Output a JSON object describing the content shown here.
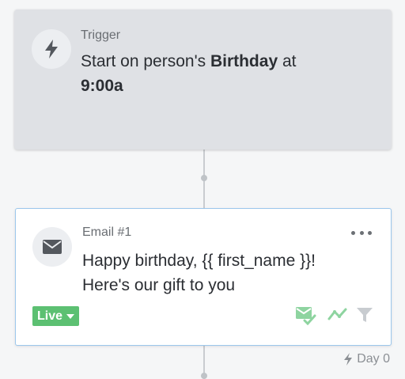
{
  "trigger": {
    "label": "Trigger",
    "text_prefix": "Start on person's ",
    "text_bold_event": "Birthday",
    "text_middle": " at",
    "text_bold_time": "9:00a",
    "icon": "bolt-icon"
  },
  "email": {
    "label": "Email #1",
    "subject_line1": "Happy birthday, {{ first_name }}!",
    "subject_line2": "Here's our gift to you",
    "status": "Live",
    "icon": "envelope-icon"
  },
  "footer": {
    "day_label": "Day 0"
  },
  "colors": {
    "live_green": "#5cc072",
    "status_icon_green": "#8ed4a0",
    "selection_border": "#9cc7ec"
  }
}
